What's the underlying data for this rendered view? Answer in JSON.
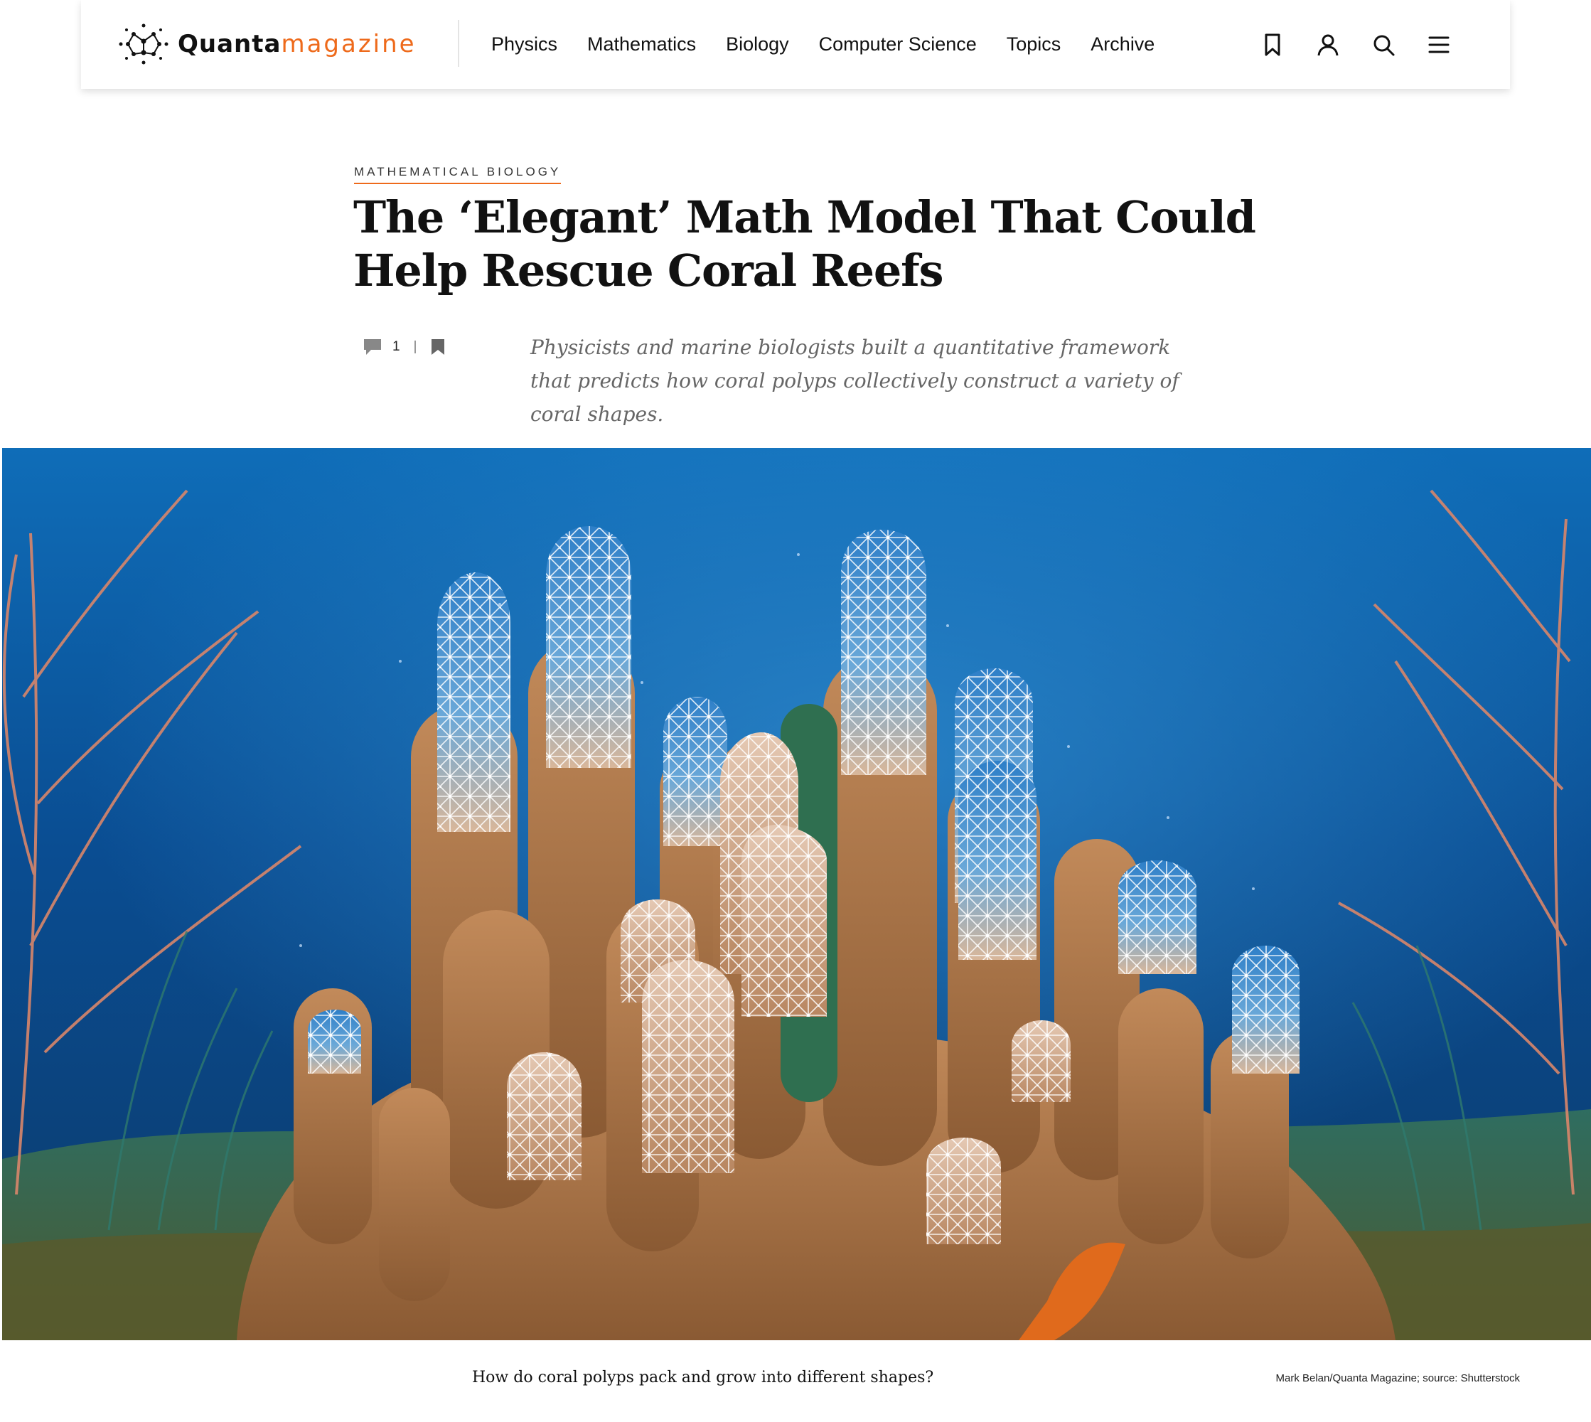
{
  "brand": {
    "name_part1": "Quanta",
    "name_part2": "magazine",
    "accent": "#ee6a1b"
  },
  "nav": [
    "Physics",
    "Mathematics",
    "Biology",
    "Computer Science",
    "Topics",
    "Archive"
  ],
  "tools": [
    "bookmark-icon",
    "user-icon",
    "search-icon",
    "menu-icon"
  ],
  "article": {
    "kicker": "MATHEMATICAL BIOLOGY",
    "title": "The ‘Elegant’ Math Model That Could Help Rescue Coral Reefs",
    "comment_count": "1",
    "dek": "Physicists and marine biologists built a quantitative framework that predicts how coral polyps collectively construct a variety of coral shapes."
  },
  "hero": {
    "caption": "How do coral polyps pack and grow into different shapes?",
    "credit": "Mark Belan/Quanta Magazine; source: Shutterstock"
  }
}
